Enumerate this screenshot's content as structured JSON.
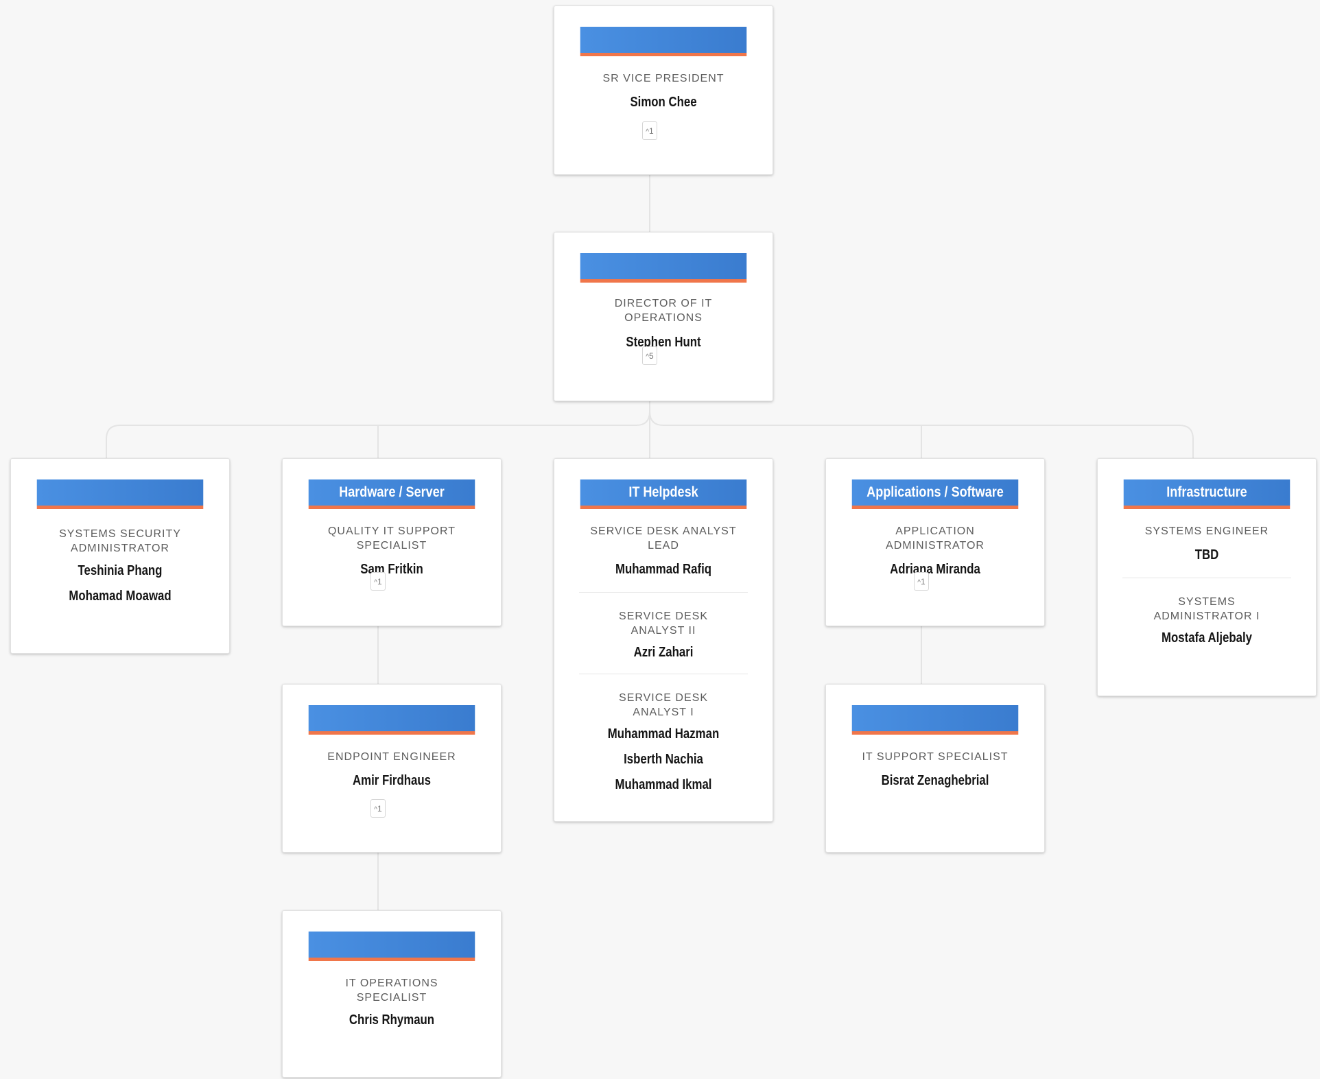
{
  "org": {
    "svp": {
      "header": "",
      "role": "SR VICE PRESIDENT",
      "people": [
        "Simon Chee"
      ],
      "badge": "1"
    },
    "director": {
      "header": "",
      "role": "DIRECTOR OF IT OPERATIONS",
      "people": [
        "Stephen Hunt"
      ],
      "badge": "5"
    },
    "security": {
      "header": "",
      "role": "SYSTEMS SECURITY ADMINISTRATOR",
      "people": [
        "Teshinia Phang",
        "Mohamad Moawad"
      ]
    },
    "hardware": {
      "header": "Hardware / Server",
      "role": "QUALITY IT SUPPORT SPECIALIST",
      "people": [
        "Sam Fritkin"
      ],
      "badge": "1"
    },
    "helpdesk": {
      "header": "IT Helpdesk",
      "sections": [
        {
          "role": "SERVICE DESK ANALYST LEAD",
          "people": [
            "Muhammad Rafiq"
          ]
        },
        {
          "role": "SERVICE DESK ANALYST II",
          "people": [
            "Azri Zahari"
          ]
        },
        {
          "role": "SERVICE DESK ANALYST I",
          "people": [
            "Muhammad Hazman",
            "Isberth Nachia",
            "Muhammad Ikmal"
          ]
        }
      ]
    },
    "applications": {
      "header": "Applications / Software",
      "role": "APPLICATION ADMINISTRATOR",
      "people": [
        "Adriana Miranda"
      ],
      "badge": "1"
    },
    "infrastructure": {
      "header": "Infrastructure",
      "sections": [
        {
          "role": "SYSTEMS ENGINEER",
          "people": [
            "TBD"
          ]
        },
        {
          "role": "SYSTEMS ADMINISTRATOR I",
          "people": [
            "Mostafa Aljebaly"
          ]
        }
      ]
    },
    "endpoint": {
      "header": "",
      "role": "ENDPOINT ENGINEER",
      "people": [
        "Amir Firdhaus"
      ],
      "badge": "1"
    },
    "itops": {
      "header": "",
      "role": "IT OPERATIONS SPECIALIST",
      "people": [
        "Chris Rhymaun"
      ]
    },
    "itsupport": {
      "header": "",
      "role": "IT SUPPORT SPECIALIST",
      "people": [
        "Bisrat Zenaghebrial"
      ]
    }
  },
  "colors": {
    "header_blue": "#4a90e2",
    "header_accent": "#f0764a",
    "connector": "#e4e4e4",
    "background": "#f7f7f7"
  },
  "icons": {
    "badge_caret": "caret-up-icon"
  }
}
